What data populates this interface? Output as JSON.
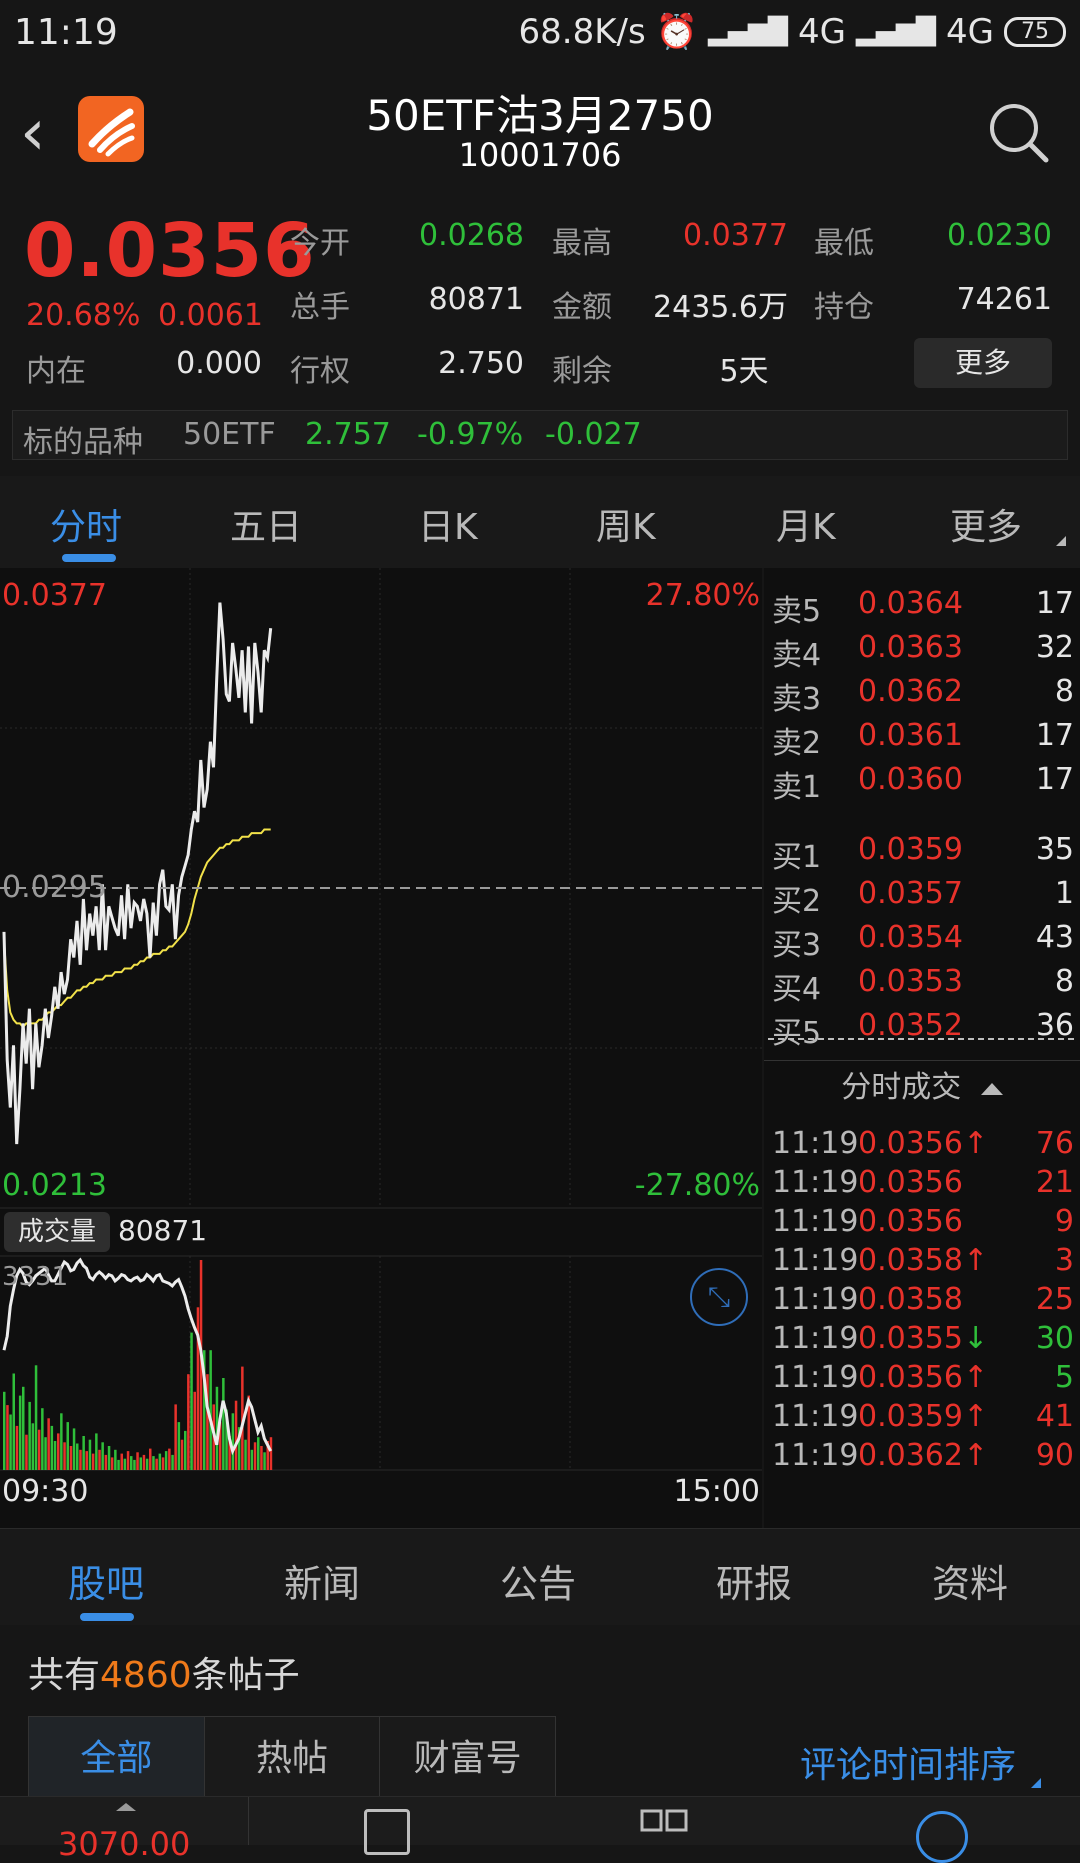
{
  "status_bar": {
    "time": "11:19",
    "net_speed": "68.8K/s",
    "net1": "4G",
    "net2": "4G",
    "battery": "75"
  },
  "header": {
    "title": "50ETF沽3月2750",
    "code": "10001706"
  },
  "quote": {
    "price": "0.0356",
    "change_pct": "20.68%",
    "change": "0.0061",
    "fields": {
      "open_label": "今开",
      "open": "0.0268",
      "high_label": "最高",
      "high": "0.0377",
      "low_label": "最低",
      "low": "0.0230",
      "volume_label": "总手",
      "volume": "80871",
      "amount_label": "金额",
      "amount": "2435.6万",
      "oi_label": "持仓",
      "oi": "74261",
      "intrinsic_label": "内在",
      "intrinsic": "0.000",
      "strike_label": "行权",
      "strike": "2.750",
      "remain_label": "剩余",
      "remain": "5天"
    },
    "more_label": "更多",
    "underlying": {
      "label": "标的品种",
      "name": "50ETF",
      "price": "2.757",
      "pct": "-0.97%",
      "chg": "-0.027"
    }
  },
  "chart_tabs": [
    "分时",
    "五日",
    "日K",
    "周K",
    "月K",
    "更多"
  ],
  "chart_axis": {
    "price_top": "0.0377",
    "price_mid": "0.0295",
    "price_bottom": "0.0213",
    "pct_top": "27.80%",
    "pct_bottom": "-27.80%",
    "vol_label": "成交量",
    "vol_value": "80871",
    "vol_max": "3331",
    "time_start": "09:30",
    "time_end": "15:00"
  },
  "order_book": {
    "asks": [
      {
        "label": "卖5",
        "price": "0.0364",
        "vol": "17"
      },
      {
        "label": "卖4",
        "price": "0.0363",
        "vol": "32"
      },
      {
        "label": "卖3",
        "price": "0.0362",
        "vol": "8"
      },
      {
        "label": "卖2",
        "price": "0.0361",
        "vol": "17"
      },
      {
        "label": "卖1",
        "price": "0.0360",
        "vol": "17"
      }
    ],
    "bids": [
      {
        "label": "买1",
        "price": "0.0359",
        "vol": "35"
      },
      {
        "label": "买2",
        "price": "0.0357",
        "vol": "1"
      },
      {
        "label": "买3",
        "price": "0.0354",
        "vol": "43"
      },
      {
        "label": "买4",
        "price": "0.0353",
        "vol": "8"
      },
      {
        "label": "买5",
        "price": "0.0352",
        "vol": "36"
      }
    ],
    "ticks_header": "分时成交",
    "ticks": [
      {
        "time": "11:19",
        "price": "0.0356",
        "arrow": "↑",
        "vol": "76",
        "pc": "red",
        "vc": "red"
      },
      {
        "time": "11:19",
        "price": "0.0356",
        "arrow": "",
        "vol": "21",
        "pc": "red",
        "vc": "red"
      },
      {
        "time": "11:19",
        "price": "0.0356",
        "arrow": "",
        "vol": "9",
        "pc": "red",
        "vc": "red"
      },
      {
        "time": "11:19",
        "price": "0.0358",
        "arrow": "↑",
        "vol": "3",
        "pc": "red",
        "vc": "red"
      },
      {
        "time": "11:19",
        "price": "0.0358",
        "arrow": "",
        "vol": "25",
        "pc": "red",
        "vc": "red"
      },
      {
        "time": "11:19",
        "price": "0.0355",
        "arrow": "↓",
        "vol": "30",
        "pc": "red",
        "vc": "green"
      },
      {
        "time": "11:19",
        "price": "0.0356",
        "arrow": "↑",
        "vol": "5",
        "pc": "red",
        "vc": "green"
      },
      {
        "time": "11:19",
        "price": "0.0359",
        "arrow": "↑",
        "vol": "41",
        "pc": "red",
        "vc": "red"
      },
      {
        "time": "11:19",
        "price": "0.0362",
        "arrow": "↑",
        "vol": "90",
        "pc": "red",
        "vc": "red"
      }
    ]
  },
  "news_tabs": [
    "股吧",
    "新闻",
    "公告",
    "研报",
    "资料"
  ],
  "posts": {
    "prefix": "共有",
    "count": "4860",
    "suffix": "条帖子"
  },
  "filter_tabs": [
    "全部",
    "热帖",
    "财富号"
  ],
  "sort_label": "评论时间排序",
  "bottom_toolbar": {
    "index_value": "3070.00"
  },
  "colors": {
    "up": "#e8322b",
    "down": "#2fbf3a",
    "accent": "#3a8ee6",
    "avg_line": "#f2e24a"
  },
  "chart_data": {
    "type": "line",
    "series": [
      {
        "values": [
          0.0283,
          0.0248,
          0.0235,
          0.0252,
          0.0225,
          0.024,
          0.0258,
          0.0247,
          0.0262,
          0.024,
          0.0258,
          0.0246,
          0.0252,
          0.0262,
          0.0254,
          0.026,
          0.0268,
          0.0262,
          0.0272,
          0.0266,
          0.027,
          0.0281,
          0.0276,
          0.0286,
          0.0274,
          0.0292,
          0.0278,
          0.0288,
          0.0282,
          0.029,
          0.0278,
          0.0296,
          0.0278,
          0.029,
          0.0287,
          0.0284,
          0.0282,
          0.0293,
          0.0281,
          0.0296,
          0.0284,
          0.0291,
          0.029,
          0.0286,
          0.0292,
          0.0288,
          0.0276,
          0.0291,
          0.0282,
          0.0296,
          0.03,
          0.029,
          0.0289,
          0.0296,
          0.0281,
          0.0293,
          0.0298,
          0.0301,
          0.0304,
          0.0311,
          0.0316,
          0.0313,
          0.033,
          0.0317,
          0.0322,
          0.0335,
          0.0328,
          0.0352,
          0.0373,
          0.0363,
          0.0348,
          0.0346,
          0.0362,
          0.0355,
          0.0347,
          0.036,
          0.0343,
          0.0361,
          0.034,
          0.0362,
          0.0354,
          0.0343,
          0.036,
          0.0358,
          0.0366
        ]
      },
      {
        "values": [
          0.0281,
          0.0267,
          0.0261,
          0.0259,
          0.0258,
          0.0258,
          0.0257,
          0.0258,
          0.0258,
          0.0258,
          0.0258,
          0.0259,
          0.0259,
          0.026,
          0.0261,
          0.0261,
          0.0262,
          0.0263,
          0.0263,
          0.0264,
          0.0265,
          0.0265,
          0.0266,
          0.0267,
          0.0267,
          0.0268,
          0.0268,
          0.0269,
          0.0269,
          0.027,
          0.027,
          0.027,
          0.0271,
          0.0271,
          0.0271,
          0.0272,
          0.0272,
          0.0272,
          0.0273,
          0.0273,
          0.0273,
          0.0274,
          0.0274,
          0.0275,
          0.0275,
          0.0276,
          0.0276,
          0.0277,
          0.0277,
          0.0277,
          0.0278,
          0.0278,
          0.0279,
          0.0279,
          0.028,
          0.0281,
          0.0282,
          0.0283,
          0.0285,
          0.0288,
          0.0292,
          0.0295,
          0.0298,
          0.03,
          0.0302,
          0.0303,
          0.0304,
          0.0305,
          0.0306,
          0.0306,
          0.0307,
          0.0307,
          0.0308,
          0.0308,
          0.0308,
          0.0309,
          0.0309,
          0.0309,
          0.031,
          0.031,
          0.031,
          0.031,
          0.0311,
          0.0311,
          0.0311
        ]
      }
    ],
    "volume": {
      "max": 3331,
      "bars": [
        {
          "v": 1240,
          "c": "g"
        },
        {
          "v": 1030,
          "c": "r"
        },
        {
          "v": 880,
          "c": "g"
        },
        {
          "v": 1530,
          "c": "g"
        },
        {
          "v": 700,
          "c": "r"
        },
        {
          "v": 1180,
          "c": "g"
        },
        {
          "v": 1320,
          "c": "g"
        },
        {
          "v": 560,
          "c": "r"
        },
        {
          "v": 1080,
          "c": "g"
        },
        {
          "v": 740,
          "c": "g"
        },
        {
          "v": 1660,
          "c": "g"
        },
        {
          "v": 640,
          "c": "r"
        },
        {
          "v": 980,
          "c": "g"
        },
        {
          "v": 520,
          "c": "g"
        },
        {
          "v": 820,
          "c": "r"
        },
        {
          "v": 700,
          "c": "g"
        },
        {
          "v": 460,
          "c": "g"
        },
        {
          "v": 580,
          "c": "r"
        },
        {
          "v": 900,
          "c": "g"
        },
        {
          "v": 440,
          "c": "r"
        },
        {
          "v": 760,
          "c": "g"
        },
        {
          "v": 380,
          "c": "r"
        },
        {
          "v": 660,
          "c": "g"
        },
        {
          "v": 420,
          "c": "g"
        },
        {
          "v": 320,
          "c": "r"
        },
        {
          "v": 540,
          "c": "g"
        },
        {
          "v": 300,
          "c": "r"
        },
        {
          "v": 480,
          "c": "g"
        },
        {
          "v": 260,
          "c": "r"
        },
        {
          "v": 580,
          "c": "g"
        },
        {
          "v": 320,
          "c": "r"
        },
        {
          "v": 440,
          "c": "g"
        },
        {
          "v": 240,
          "c": "r"
        },
        {
          "v": 380,
          "c": "g"
        },
        {
          "v": 200,
          "c": "r"
        },
        {
          "v": 320,
          "c": "g"
        },
        {
          "v": 160,
          "c": "g"
        },
        {
          "v": 260,
          "c": "r"
        },
        {
          "v": 180,
          "c": "g"
        },
        {
          "v": 300,
          "c": "r"
        },
        {
          "v": 220,
          "c": "g"
        },
        {
          "v": 160,
          "c": "g"
        },
        {
          "v": 280,
          "c": "r"
        },
        {
          "v": 200,
          "c": "g"
        },
        {
          "v": 240,
          "c": "r"
        },
        {
          "v": 180,
          "c": "g"
        },
        {
          "v": 340,
          "c": "r"
        },
        {
          "v": 220,
          "c": "g"
        },
        {
          "v": 180,
          "c": "r"
        },
        {
          "v": 260,
          "c": "g"
        },
        {
          "v": 200,
          "c": "r"
        },
        {
          "v": 300,
          "c": "g"
        },
        {
          "v": 340,
          "c": "r"
        },
        {
          "v": 240,
          "c": "g"
        },
        {
          "v": 1040,
          "c": "r"
        },
        {
          "v": 760,
          "c": "g"
        },
        {
          "v": 480,
          "c": "r"
        },
        {
          "v": 620,
          "c": "g"
        },
        {
          "v": 1520,
          "c": "r"
        },
        {
          "v": 2180,
          "c": "g"
        },
        {
          "v": 1240,
          "c": "r"
        },
        {
          "v": 2580,
          "c": "r"
        },
        {
          "v": 3331,
          "c": "r"
        },
        {
          "v": 1900,
          "c": "g"
        },
        {
          "v": 1520,
          "c": "r"
        },
        {
          "v": 1900,
          "c": "g"
        },
        {
          "v": 1040,
          "c": "r"
        },
        {
          "v": 1320,
          "c": "g"
        },
        {
          "v": 760,
          "c": "r"
        },
        {
          "v": 1460,
          "c": "g"
        },
        {
          "v": 960,
          "c": "g"
        },
        {
          "v": 540,
          "c": "r"
        },
        {
          "v": 900,
          "c": "g"
        },
        {
          "v": 1100,
          "c": "r"
        },
        {
          "v": 680,
          "c": "g"
        },
        {
          "v": 1640,
          "c": "r"
        },
        {
          "v": 480,
          "c": "g"
        },
        {
          "v": 1180,
          "c": "r"
        },
        {
          "v": 320,
          "c": "g"
        },
        {
          "v": 440,
          "c": "r"
        },
        {
          "v": 520,
          "c": "g"
        },
        {
          "v": 380,
          "c": "r"
        },
        {
          "v": 280,
          "c": "g"
        },
        {
          "v": 460,
          "c": "r"
        },
        {
          "v": 520,
          "c": "r"
        }
      ],
      "volume_line": [
        1900,
        2120,
        2600,
        2860,
        3080,
        3180,
        3120,
        2980,
        2940,
        3000,
        3080,
        3120,
        3160,
        3200,
        3100,
        3000,
        3000,
        3100,
        3200,
        3300,
        3260,
        3160,
        3180,
        3280,
        3331,
        3240,
        3200,
        3060,
        3020,
        3100,
        3140,
        3100,
        3040,
        3100,
        3080,
        3000,
        3040,
        3100,
        3080,
        3020,
        3000,
        3040,
        3060,
        3000,
        3020,
        3100,
        3060,
        3000,
        3080,
        3100,
        3000,
        2980,
        2960,
        2920,
        2980,
        3020,
        2900,
        2760,
        2560,
        2400,
        2260,
        2140,
        1900,
        1500,
        1000,
        800,
        600,
        400,
        800,
        1100,
        900,
        500,
        300,
        400,
        500,
        700,
        900,
        1100,
        1000,
        800,
        600,
        700,
        500,
        400,
        300
      ]
    },
    "ylim": [
      0.0213,
      0.0377
    ],
    "reference": 0.0295
  }
}
